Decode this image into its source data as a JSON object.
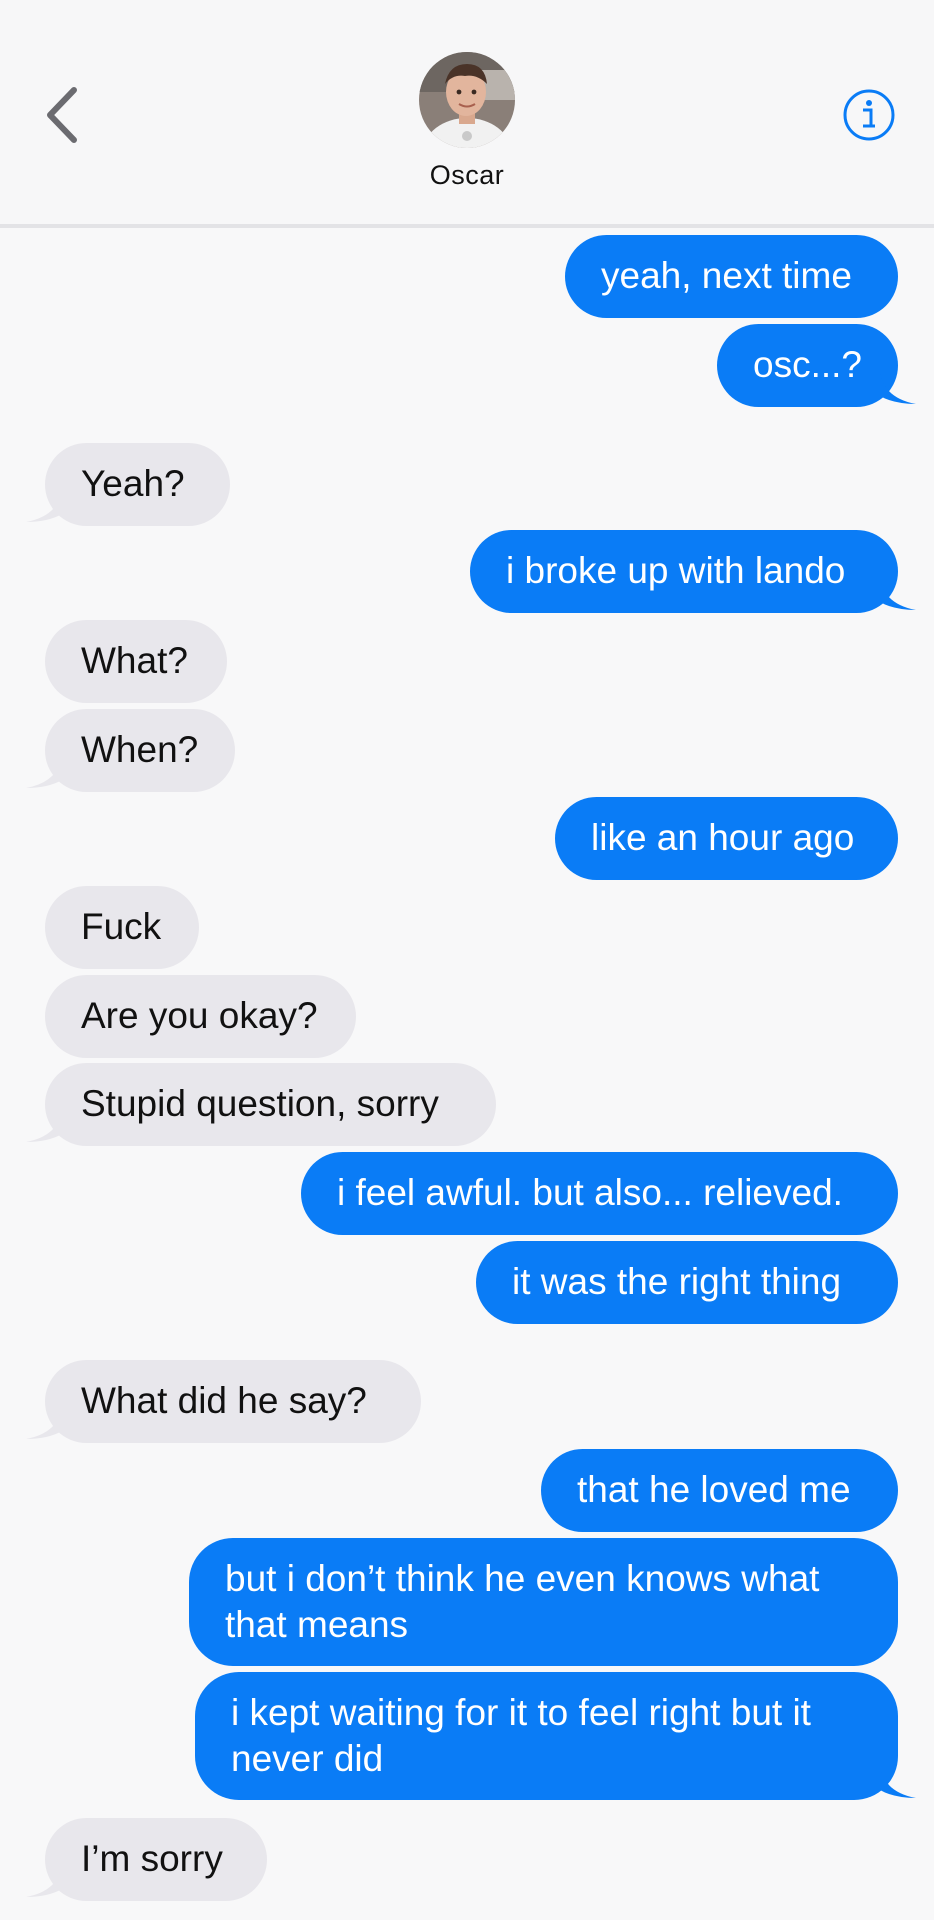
{
  "header": {
    "contact_name": "Oscar",
    "back_icon": "chevron-left-icon",
    "info_icon": "info-icon",
    "accent_color": "#0a7cf6"
  },
  "messages": [
    {
      "direction": "outgoing",
      "text": "yeah, next time"
    },
    {
      "direction": "outgoing",
      "text": "osc...?"
    },
    {
      "direction": "incoming",
      "text": "Yeah?"
    },
    {
      "direction": "outgoing",
      "text": "i broke up with lando"
    },
    {
      "direction": "incoming",
      "text": "What?"
    },
    {
      "direction": "incoming",
      "text": "When?"
    },
    {
      "direction": "outgoing",
      "text": "like an hour ago"
    },
    {
      "direction": "incoming",
      "text": "Fuck"
    },
    {
      "direction": "incoming",
      "text": "Are you okay?"
    },
    {
      "direction": "incoming",
      "text": "Stupid question, sorry"
    },
    {
      "direction": "outgoing",
      "text": "i feel awful. but also... relieved."
    },
    {
      "direction": "outgoing",
      "text": "it was the right thing"
    },
    {
      "direction": "incoming",
      "text": "What did he say?"
    },
    {
      "direction": "outgoing",
      "text": "that he loved me"
    },
    {
      "direction": "outgoing",
      "text": "but i don’t think he even knows what that means"
    },
    {
      "direction": "outgoing",
      "text": "i kept waiting for it to feel right but it never did"
    },
    {
      "direction": "incoming",
      "text": "I’m sorry"
    }
  ],
  "colors": {
    "outgoing_bubble": "#0a7cf6",
    "incoming_bubble": "#e8e7ec"
  }
}
